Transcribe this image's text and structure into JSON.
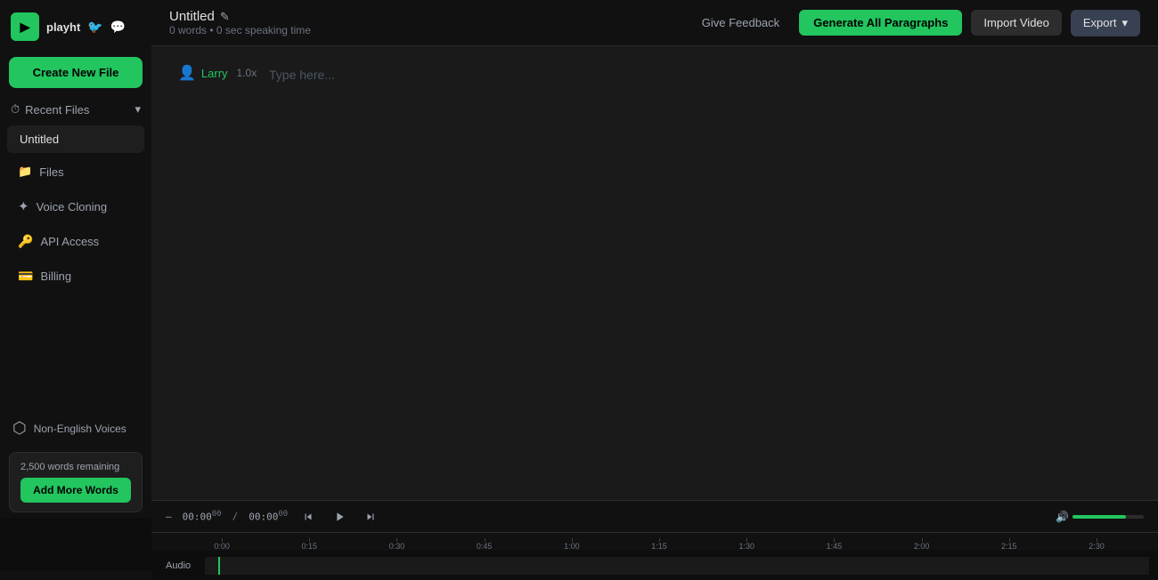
{
  "sidebar": {
    "logo": {
      "text": "playht",
      "icon_label": "P"
    },
    "create_new_btn": "Create New File",
    "recent_files_header": "Recent Files",
    "recent_files": [
      {
        "name": "Untitled"
      }
    ],
    "nav_items": [
      {
        "id": "files",
        "label": "Files",
        "icon": "folder"
      },
      {
        "id": "voice-cloning",
        "label": "Voice Cloning",
        "icon": "sparkles"
      },
      {
        "id": "api-access",
        "label": "API Access",
        "icon": "key"
      },
      {
        "id": "billing",
        "label": "Billing",
        "icon": "credit-card"
      }
    ],
    "non_english_voices_label": "Non-English Voices",
    "words_remaining": "2,500 words remaining",
    "add_more_words_btn": "Add More Words"
  },
  "top_bar": {
    "title": "Untitled",
    "meta": "0 words • 0 sec speaking time",
    "feedback_btn": "Give Feedback",
    "generate_btn": "Generate All Paragraphs",
    "import_video_btn": "Import Video",
    "export_btn": "Export"
  },
  "editor": {
    "speaker_name": "Larry",
    "speed": "1.0x",
    "placeholder": "Type here..."
  },
  "timeline": {
    "current_time": "00:00",
    "current_ms": "00",
    "total_time": "00:00",
    "total_ms": "00",
    "divider": "/",
    "dash": "—",
    "ruler_ticks": [
      "0:00",
      "0:15",
      "0:30",
      "0:45",
      "1:00",
      "1:15",
      "1:30",
      "1:45",
      "2:00",
      "2:15",
      "2:30"
    ],
    "track_label": "Audio"
  },
  "icons": {
    "logo": "▶",
    "twitter": "🐦",
    "discord": "💬",
    "folder": "📁",
    "sparkles": "✦",
    "key": "🔑",
    "billing": "💳",
    "chevron_down": "▾",
    "clock": "⏱",
    "person": "👤",
    "translate": "⬡",
    "skip_back": "⏮",
    "play": "▶",
    "skip_forward": "⏭",
    "volume": "🔊",
    "pencil": "✎"
  }
}
